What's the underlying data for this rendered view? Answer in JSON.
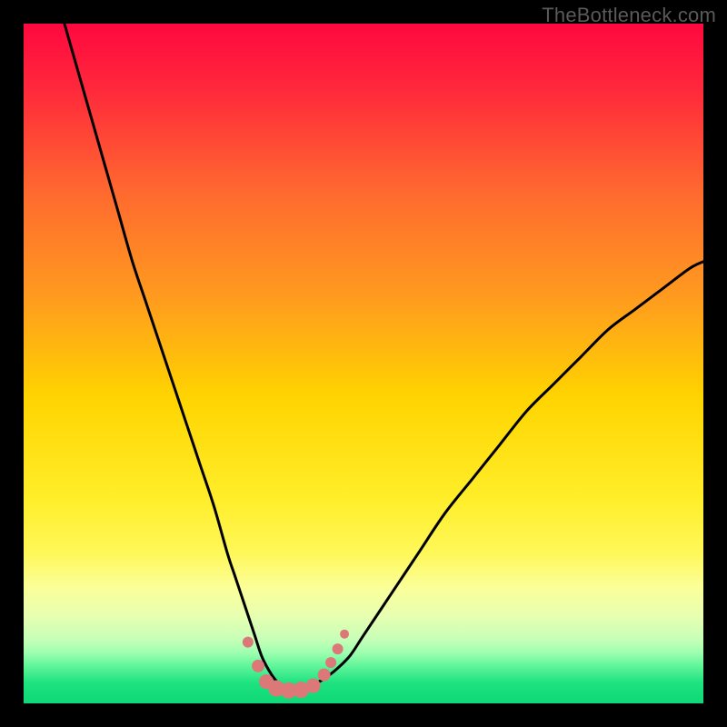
{
  "watermark": {
    "text": "TheBottleneck.com"
  },
  "colors": {
    "black": "#000000",
    "curve": "#000000",
    "marker_fill": "#dd7878",
    "marker_stroke": "#c85a5a",
    "gradient_stops": [
      {
        "offset": 0.0,
        "color": "#ff083f"
      },
      {
        "offset": 0.1,
        "color": "#ff2a3b"
      },
      {
        "offset": 0.25,
        "color": "#ff6a2f"
      },
      {
        "offset": 0.4,
        "color": "#ff9a1f"
      },
      {
        "offset": 0.55,
        "color": "#ffd400"
      },
      {
        "offset": 0.7,
        "color": "#ffee2a"
      },
      {
        "offset": 0.78,
        "color": "#fff85a"
      },
      {
        "offset": 0.83,
        "color": "#fbff99"
      },
      {
        "offset": 0.87,
        "color": "#e8ffb0"
      },
      {
        "offset": 0.905,
        "color": "#c8ffb8"
      },
      {
        "offset": 0.925,
        "color": "#9fffb0"
      },
      {
        "offset": 0.945,
        "color": "#60f59a"
      },
      {
        "offset": 0.97,
        "color": "#1de280"
      },
      {
        "offset": 1.0,
        "color": "#0fd876"
      }
    ]
  },
  "chart_data": {
    "type": "line",
    "title": "",
    "xlabel": "",
    "ylabel": "",
    "xlim": [
      0,
      100
    ],
    "ylim": [
      0,
      100
    ],
    "grid": false,
    "legend": false,
    "series": [
      {
        "name": "bottleneck-curve",
        "x": [
          6,
          8,
          10,
          12,
          14,
          16,
          18,
          20,
          22,
          24,
          26,
          28,
          30,
          31,
          32,
          33,
          34,
          35,
          36,
          37,
          38,
          39,
          40,
          42,
          44,
          46,
          48,
          50,
          54,
          58,
          62,
          66,
          70,
          74,
          78,
          82,
          86,
          90,
          94,
          98,
          100
        ],
        "values": [
          100,
          93,
          86,
          79,
          72,
          65,
          59,
          53,
          47,
          41,
          35,
          29,
          22,
          19,
          16,
          13,
          10,
          7,
          5,
          3.5,
          2.5,
          2,
          2,
          2.5,
          3.5,
          5,
          7,
          10,
          16,
          22,
          28,
          33,
          38,
          43,
          47,
          51,
          55,
          58,
          61,
          64,
          65
        ]
      }
    ],
    "markers": {
      "name": "bottom-cluster",
      "points": [
        {
          "x": 33.0,
          "y": 9.0,
          "r": 6
        },
        {
          "x": 34.5,
          "y": 5.5,
          "r": 7
        },
        {
          "x": 35.7,
          "y": 3.2,
          "r": 8
        },
        {
          "x": 37.2,
          "y": 2.2,
          "r": 9
        },
        {
          "x": 39.0,
          "y": 1.9,
          "r": 9
        },
        {
          "x": 40.8,
          "y": 2.0,
          "r": 9
        },
        {
          "x": 42.6,
          "y": 2.6,
          "r": 8
        },
        {
          "x": 44.2,
          "y": 4.2,
          "r": 7
        },
        {
          "x": 45.2,
          "y": 6.0,
          "r": 6
        },
        {
          "x": 46.2,
          "y": 8.0,
          "r": 6
        },
        {
          "x": 47.2,
          "y": 10.2,
          "r": 5
        }
      ]
    }
  }
}
